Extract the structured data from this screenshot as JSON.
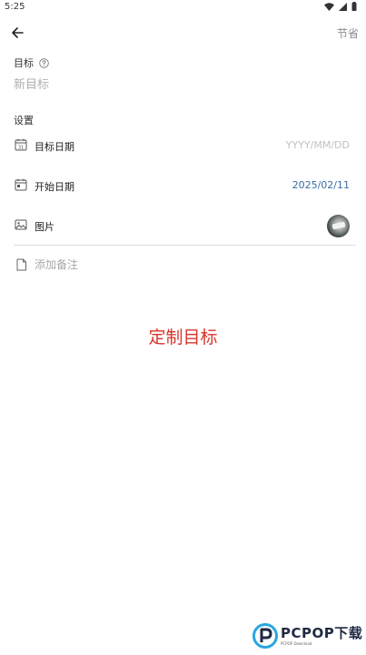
{
  "status_bar": {
    "time": "5:25"
  },
  "app_bar": {
    "save_label": "节省"
  },
  "goal": {
    "label": "目标",
    "placeholder": "新目标"
  },
  "settings": {
    "label": "设置",
    "target_date": {
      "label": "目标日期",
      "placeholder": "YYYY/MM/DD"
    },
    "start_date": {
      "label": "开始日期",
      "value": "2025/02/11"
    },
    "image": {
      "label": "图片"
    }
  },
  "note": {
    "placeholder": "添加备注"
  },
  "caption": "定制目标",
  "watermark": {
    "title": "PCPOP下载",
    "subtitle": "PCPOP Download"
  },
  "colors": {
    "accent": "#3a6ea5",
    "caption": "#d9342b",
    "muted": "#b0b0b0"
  },
  "icons": [
    "back-arrow-icon",
    "help-icon",
    "calendar-icon",
    "calendar-start-icon",
    "image-icon",
    "note-icon"
  ]
}
